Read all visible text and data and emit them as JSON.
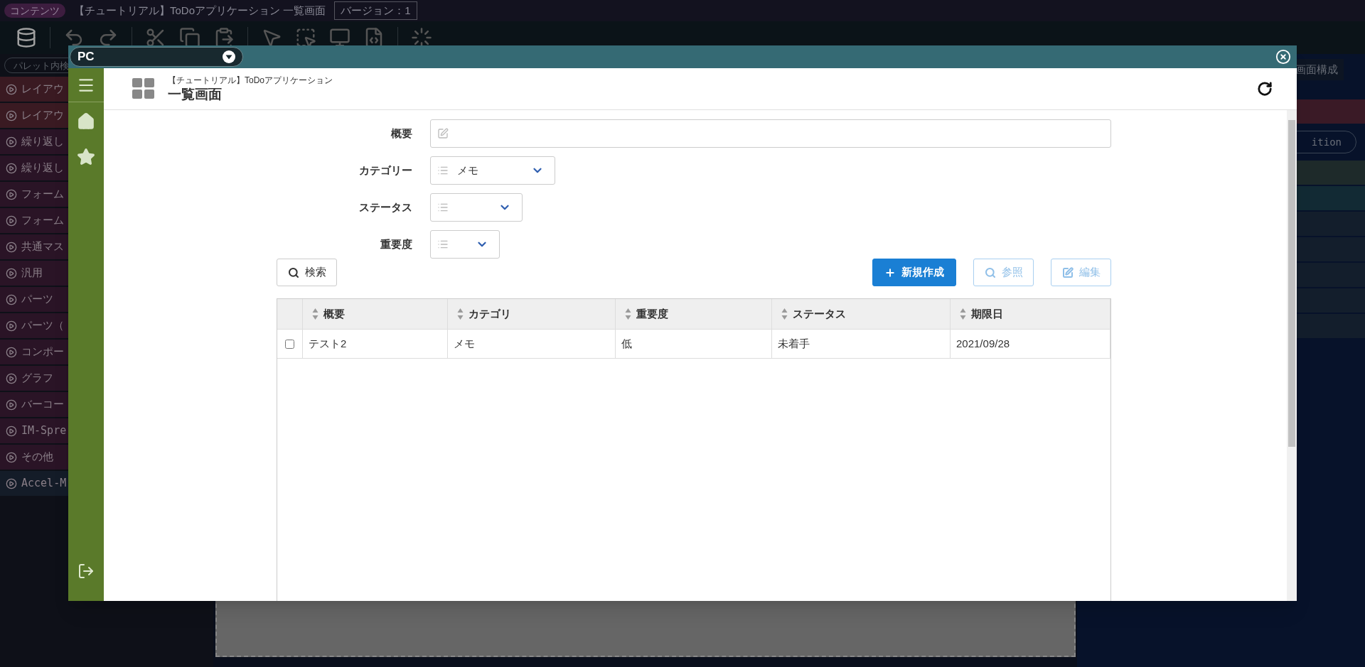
{
  "top_bar": {
    "badge": "コンテンツ",
    "title": "【チュートリアル】ToDoアプリケーション 一覧画面",
    "version": "バージョン：1"
  },
  "palette": {
    "search_placeholder": "パレット内検",
    "items": [
      {
        "label": "レイアウ",
        "color": "#3a1a22"
      },
      {
        "label": "レイアウ",
        "color": "#3a1a22"
      },
      {
        "label": "繰り返し",
        "color": "#2a1426"
      },
      {
        "label": "繰り返し",
        "color": "#2a1426"
      },
      {
        "label": "フォーム",
        "color": "#2a1426"
      },
      {
        "label": "フォーム",
        "color": "#2a1426"
      },
      {
        "label": "共通マス",
        "color": "#2a1426"
      },
      {
        "label": "汎用",
        "color": "#2a1426"
      },
      {
        "label": "パーツ",
        "color": "#2a1426"
      },
      {
        "label": "パーツ（",
        "color": "#2a1426"
      },
      {
        "label": "コンポー",
        "color": "#2a1426"
      },
      {
        "label": "グラフ",
        "color": "#2a1426"
      },
      {
        "label": "バーコー",
        "color": "#2a1426"
      },
      {
        "label": "IM-Spre",
        "color": "#2a1426"
      },
      {
        "label": "その他",
        "color": "#2a1426"
      },
      {
        "label": "Accel-M",
        "color": "#141c28"
      }
    ]
  },
  "right_panel": {
    "tab": "画面構成",
    "pill": "ition",
    "rows": [
      {
        "color": "#3a1a26"
      },
      {
        "color": "#1e2a2a"
      },
      {
        "color": "#122a34"
      },
      {
        "color": "#131e2c"
      },
      {
        "color": "#131e2c"
      },
      {
        "color": "#131e2c"
      },
      {
        "color": "#131e2c"
      },
      {
        "color": "#131e2c"
      }
    ]
  },
  "modal": {
    "device": "PC",
    "app_title": "【チュートリアル】ToDoアプリケーション",
    "page_title": "一覧画面",
    "form": [
      {
        "label": "概要",
        "kind": "text"
      },
      {
        "label": "カテゴリー",
        "kind": "select",
        "value": "メモ"
      },
      {
        "label": "ステータス",
        "kind": "select"
      },
      {
        "label": "重要度",
        "kind": "select"
      }
    ],
    "buttons": [
      {
        "label": "検索",
        "kind": "search",
        "disabled": false
      },
      {
        "label": "新規作成",
        "kind": "create",
        "disabled": false
      },
      {
        "label": "参照",
        "kind": "view",
        "disabled": true
      },
      {
        "label": "編集",
        "kind": "edit",
        "disabled": true
      }
    ],
    "table": {
      "columns": [
        "概要",
        "カテゴリ",
        "重要度",
        "ステータス",
        "期限日"
      ],
      "rows": [
        {
          "checked": false,
          "cells": [
            "テスト2",
            "メモ",
            "低",
            "未着手",
            "2021/09/28"
          ]
        }
      ]
    }
  }
}
